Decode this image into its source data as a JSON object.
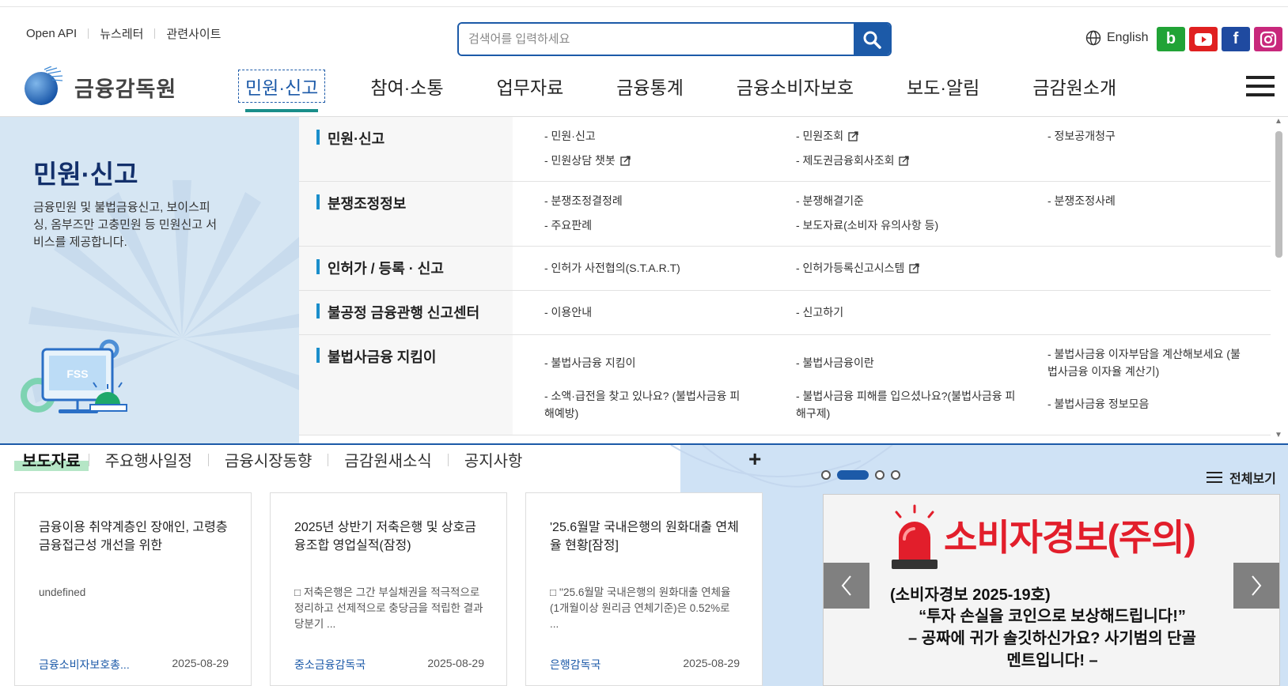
{
  "util": {
    "links": [
      "Open API",
      "뉴스레터",
      "관련사이트"
    ],
    "search_placeholder": "검색어를 입력하세요",
    "language": "English",
    "sns": [
      {
        "name": "blog",
        "glyph": "b",
        "color": "#21a336"
      },
      {
        "name": "youtube",
        "glyph": "",
        "color": "#e02020"
      },
      {
        "name": "facebook",
        "glyph": "f",
        "color": "#1f4aa0"
      },
      {
        "name": "instagram",
        "glyph": "",
        "color": "#c8287c"
      }
    ]
  },
  "brand": {
    "logo_text": "금융감독원"
  },
  "gnb": {
    "items": [
      "민원·신고",
      "참여·소통",
      "업무자료",
      "금융통계",
      "금융소비자보호",
      "보도·알림",
      "금감원소개"
    ],
    "active_index": 0
  },
  "mega": {
    "title": "민원·신고",
    "desc": "금융민원 및 불법금융신고, 보이스피싱, 옴부즈만 고충민원 등 민원신고 서비스를 제공합니다.",
    "illustration_label": "FSS",
    "rows": [
      {
        "category": "민원·신고",
        "links": [
          {
            "label": "- 민원·신고",
            "external": false
          },
          {
            "label": "- 민원조회",
            "external": true
          },
          {
            "label": "- 정보공개청구",
            "external": false
          },
          {
            "label": "- 민원상담 챗봇",
            "external": true
          },
          {
            "label": "- 제도권금융회사조회",
            "external": true
          }
        ]
      },
      {
        "category": "분쟁조정정보",
        "links": [
          {
            "label": "- 분쟁조정결정례",
            "external": false
          },
          {
            "label": "- 분쟁해결기준",
            "external": false
          },
          {
            "label": "- 분쟁조정사례",
            "external": false
          },
          {
            "label": "- 주요판례",
            "external": false
          },
          {
            "label": "- 보도자료(소비자 유의사항 등)",
            "external": false
          }
        ]
      },
      {
        "category": "인허가 / 등록 · 신고",
        "links": [
          {
            "label": "- 인허가 사전협의(S.T.A.R.T)",
            "external": false
          },
          {
            "label": "- 인허가등록신고시스템",
            "external": true
          }
        ]
      },
      {
        "category": "불공정 금융관행 신고센터",
        "links": [
          {
            "label": "- 이용안내",
            "external": false
          },
          {
            "label": "- 신고하기",
            "external": false
          }
        ]
      },
      {
        "category": "불법사금융 지킴이",
        "links": [
          {
            "label": "- 불법사금융 지킴이",
            "external": false
          },
          {
            "label": "- 불법사금융이란",
            "external": false
          },
          {
            "label": "- 불법사금융 이자부담을 계산해보세요 (불법사금융 이자율 계산기)",
            "external": false
          },
          {
            "label": "- 소액·급전을 찾고 있나요? (불법사금융 피해예방)",
            "external": false
          },
          {
            "label": "- 불법사금융 피해를 입으셨나요?(불법사금융 피해구제)",
            "external": false
          },
          {
            "label": "- 불법사금융 정보모음",
            "external": false
          }
        ]
      }
    ]
  },
  "news": {
    "tabs": [
      "보도자료",
      "주요행사일정",
      "금융시장동향",
      "금감원새소식",
      "공지사항"
    ],
    "active_tab": 0,
    "more": "+",
    "cards": [
      {
        "title": "금융이용 취약계층인 장애인, 고령층 금융접근성 개선을 위한",
        "summary": "undefined",
        "dept": "금융소비자보호총...",
        "date": "2025-08-29"
      },
      {
        "title": "2025년 상반기 저축은행 및 상호금융조합 영업실적(잠정)",
        "summary": "□ 저축은행은 그간 부실채권을 적극적으로 정리하고 선제적으로 충당금을 적립한 결과 당분기 ...",
        "dept": "중소금융감독국",
        "date": "2025-08-29"
      },
      {
        "title": "'25.6월말 국내은행의 원화대출 연체율 현황[잠정]",
        "summary": "□ ''25.6월말 국내은행의 원화대출 연체율(1개월이상 원리금 연체기준)은 0.52%로 ...",
        "dept": "은행감독국",
        "date": "2025-08-29"
      }
    ]
  },
  "banner": {
    "view_all": "전체보기",
    "slide_count": 4,
    "active_slide": 1,
    "headline": "소비자경보(주의)",
    "subhead": "(소비자경보 2025-19호)",
    "line1": "“투자 손실을 코인으로 보상해드립니다!”",
    "line2": "– 공짜에 귀가 솔깃하신가요? 사기범의 단골",
    "line3": "멘트입니다! –"
  },
  "colors": {
    "brand_blue": "#1c5aa8",
    "accent_teal": "#1a8e8a",
    "alert_red": "#e21e2b",
    "panel_bg": "#d6e6f3"
  }
}
